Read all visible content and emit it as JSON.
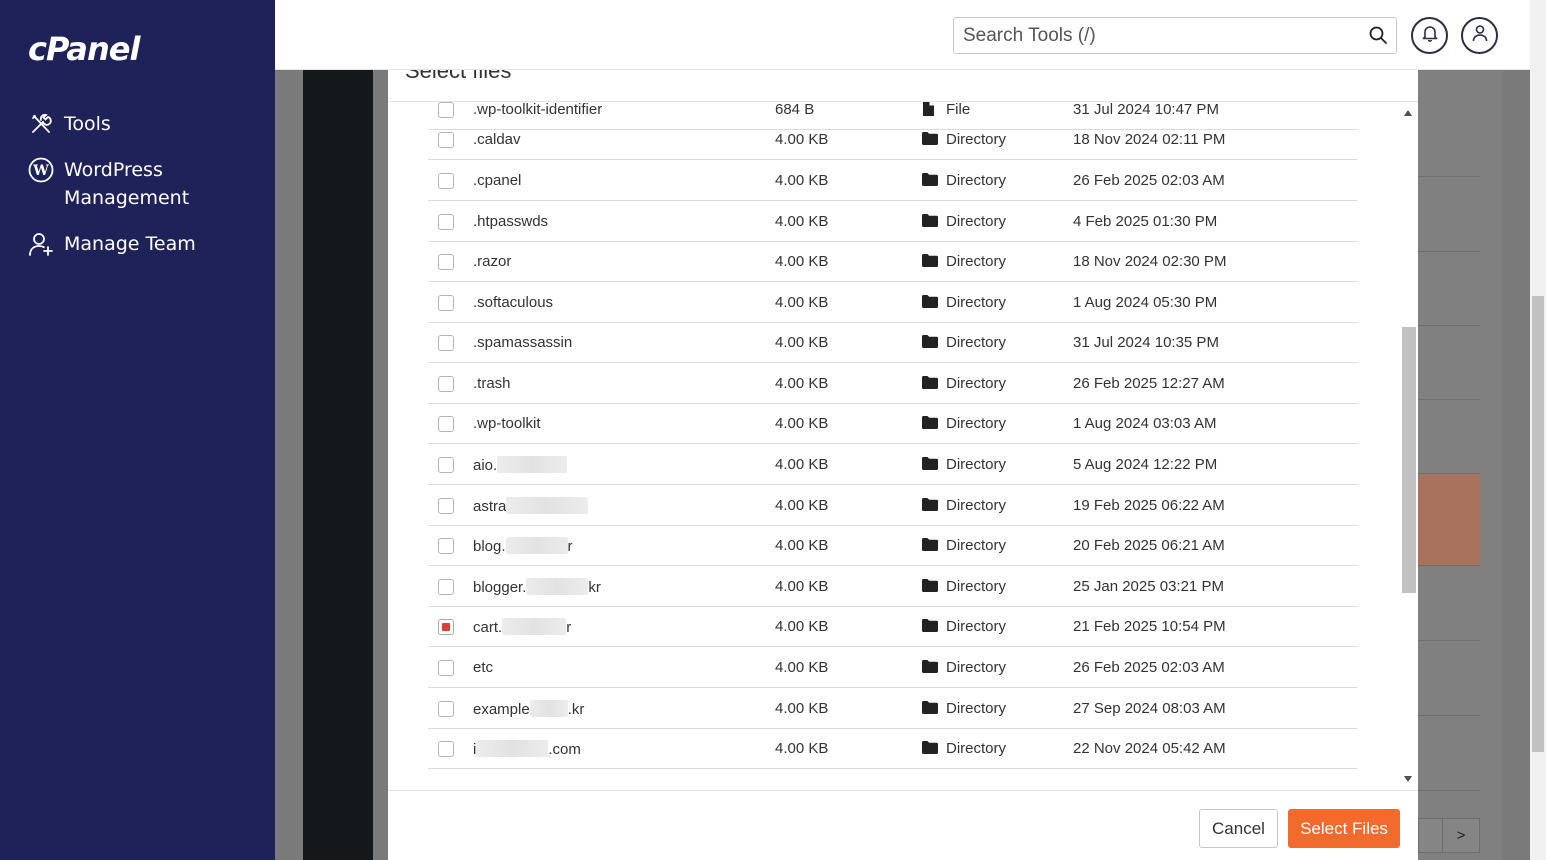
{
  "app": {
    "logo": "cPanel"
  },
  "sidebar": {
    "items": [
      {
        "label": "Tools",
        "icon": "tools-icon"
      },
      {
        "label": "WordPress Management",
        "line1": "WordPress",
        "line2": "Management",
        "icon": "wordpress-icon"
      },
      {
        "label": "Manage Team",
        "icon": "manage-team-icon"
      }
    ]
  },
  "header": {
    "search_placeholder": "Search Tools (/)",
    "icons": [
      "search-icon",
      "bell-icon",
      "user-icon"
    ]
  },
  "modal": {
    "title": "Select files",
    "cancel_label": "Cancel",
    "select_label": "Select Files",
    "rows": [
      {
        "name": ".wp-toolkit-identifier",
        "size": "684 B",
        "type": "File",
        "date": "31 Jul 2024 10:47 PM",
        "checked": false
      },
      {
        "name": ".caldav",
        "size": "4.00 KB",
        "type": "Directory",
        "date": "18 Nov 2024 02:11 PM",
        "checked": false
      },
      {
        "name": ".cpanel",
        "size": "4.00 KB",
        "type": "Directory",
        "date": "26 Feb 2025 02:03 AM",
        "checked": false
      },
      {
        "name": ".htpasswds",
        "size": "4.00 KB",
        "type": "Directory",
        "date": "4 Feb 2025 01:30 PM",
        "checked": false
      },
      {
        "name": ".razor",
        "size": "4.00 KB",
        "type": "Directory",
        "date": "18 Nov 2024 02:30 PM",
        "checked": false
      },
      {
        "name": ".softaculous",
        "size": "4.00 KB",
        "type": "Directory",
        "date": "1 Aug 2024 05:30 PM",
        "checked": false
      },
      {
        "name": ".spamassassin",
        "size": "4.00 KB",
        "type": "Directory",
        "date": "31 Jul 2024 10:35 PM",
        "checked": false
      },
      {
        "name": ".trash",
        "size": "4.00 KB",
        "type": "Directory",
        "date": "26 Feb 2025 12:27 AM",
        "checked": false
      },
      {
        "name": ".wp-toolkit",
        "size": "4.00 KB",
        "type": "Directory",
        "date": "1 Aug 2024 03:03 AM",
        "checked": false
      },
      {
        "name": "aio.",
        "name_suffix": "",
        "size": "4.00 KB",
        "type": "Directory",
        "date": "5 Aug 2024 12:22 PM",
        "checked": false
      },
      {
        "name": "astra",
        "name_suffix": "",
        "size": "4.00 KB",
        "type": "Directory",
        "date": "19 Feb 2025 06:22 AM",
        "checked": false
      },
      {
        "name": "blog.",
        "name_suffix": "r",
        "size": "4.00 KB",
        "type": "Directory",
        "date": "20 Feb 2025 06:21 AM",
        "checked": false
      },
      {
        "name": "blogger.",
        "name_suffix": "kr",
        "size": "4.00 KB",
        "type": "Directory",
        "date": "25 Jan 2025 03:21 PM",
        "checked": false
      },
      {
        "name": "cart.",
        "name_suffix": "r",
        "size": "4.00 KB",
        "type": "Directory",
        "date": "21 Feb 2025 10:54 PM",
        "checked": true
      },
      {
        "name": "etc",
        "size": "4.00 KB",
        "type": "Directory",
        "date": "26 Feb 2025 02:03 AM",
        "checked": false
      },
      {
        "name": "example",
        "name_suffix": ".kr",
        "size": "4.00 KB",
        "type": "Directory",
        "date": "27 Sep 2024 08:03 AM",
        "checked": false
      },
      {
        "name": "i",
        "name_suffix": ".com",
        "size": "4.00 KB",
        "type": "Directory",
        "date": "22 Nov 2024 05:42 AM",
        "checked": false
      }
    ]
  },
  "background": {
    "pager_next": ">",
    "highlight_color": "#a8725c"
  },
  "colors": {
    "sidebar_bg": "#1f2258",
    "primary_button": "#f26b2c",
    "checkbox_checked": "#d9403a"
  }
}
